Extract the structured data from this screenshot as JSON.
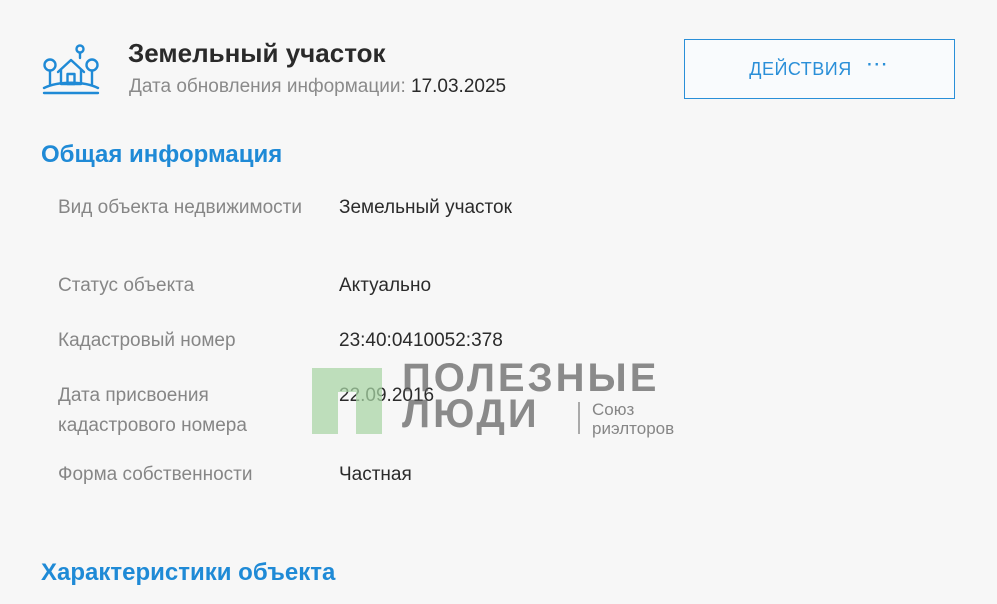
{
  "header": {
    "icon": "house-plot-icon",
    "title": "Земельный участок",
    "update_label": "Дата обновления информации:",
    "update_date": "17.03.2025"
  },
  "actions": {
    "label": "ДЕЙСТВИЯ",
    "icon": "more-dots-icon",
    "icon_glyph": "⋯"
  },
  "sections": {
    "general_title": "Общая информация",
    "characteristics_title": "Характеристики объекта"
  },
  "general_info": [
    {
      "label": "Вид объекта недвижимости",
      "value": "Земельный участок"
    },
    {
      "label": "Статус объекта",
      "value": "Актуально"
    },
    {
      "label": "Кадастровый номер",
      "value": "23:40:0410052:378"
    },
    {
      "label": "Дата присвоения кадастрового номера",
      "value": "22.09.2016"
    },
    {
      "label": "Форма собственности",
      "value": "Частная"
    }
  ],
  "watermark": {
    "line1": "ПОЛЕЗНЫЕ",
    "line2": "ЛЮДИ",
    "sub1": "Союз",
    "sub2": "риэлторов"
  },
  "colors": {
    "accent": "#1f8ad6",
    "label": "#868686",
    "text": "#2b2b2b",
    "background": "#f7f7f7",
    "watermark_green": "#a8d5a4"
  }
}
